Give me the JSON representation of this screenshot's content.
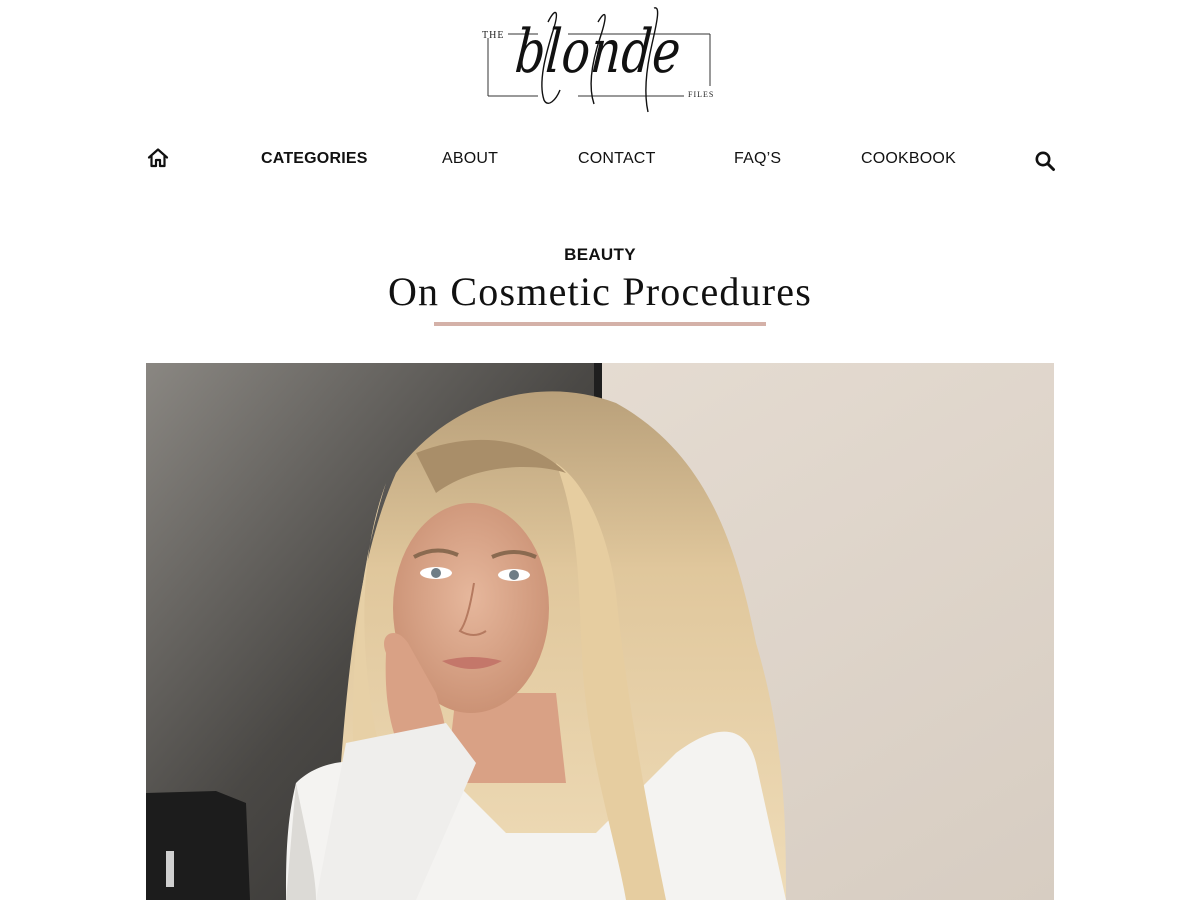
{
  "logo": {
    "the": "THE",
    "script": "blonde",
    "files": "FILES"
  },
  "nav": {
    "home_icon": "home-icon",
    "items": [
      {
        "label": "CATEGORIES",
        "bold": true
      },
      {
        "label": "ABOUT",
        "bold": false
      },
      {
        "label": "CONTACT",
        "bold": false
      },
      {
        "label": "FAQ’S",
        "bold": false
      },
      {
        "label": "COOKBOOK",
        "bold": false
      }
    ],
    "search_icon": "search-icon"
  },
  "post": {
    "category": "BEAUTY",
    "title": "On Cosmetic Procedures"
  },
  "colors": {
    "accent_underline": "#d4b1a8",
    "text": "#111111",
    "background": "#ffffff"
  }
}
